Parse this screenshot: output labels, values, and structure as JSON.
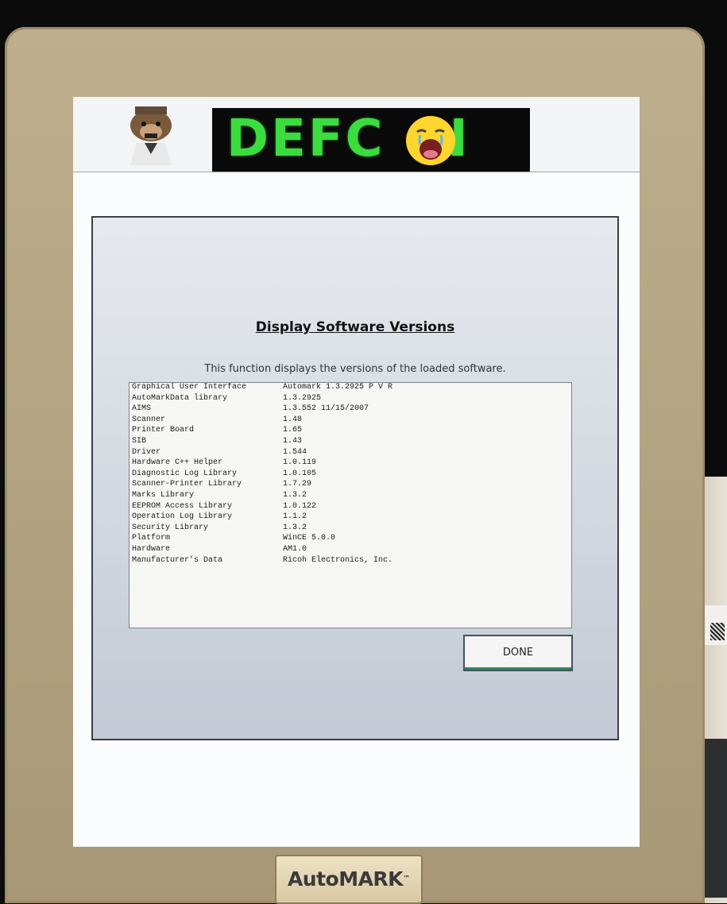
{
  "header": {
    "banner_text": "DEFC  N",
    "logo_icon": "crying-face-icon",
    "mascot_icon": "mascot-icon"
  },
  "dialog": {
    "title": "Display Software Versions",
    "subtitle": "This function displays the versions of the loaded software.",
    "rows": [
      {
        "name": "Graphical User Interface",
        "version": "Automark 1.3.2925 P V R"
      },
      {
        "name": "AutoMarkData library",
        "version": "1.3.2925"
      },
      {
        "name": "AIMS",
        "version": "1.3.552 11/15/2007"
      },
      {
        "name": "Scanner",
        "version": "1.48"
      },
      {
        "name": "Printer Board",
        "version": "1.65"
      },
      {
        "name": "SIB",
        "version": "1.43"
      },
      {
        "name": "Driver",
        "version": "1.544"
      },
      {
        "name": "Hardware C++ Helper",
        "version": "1.0.119"
      },
      {
        "name": "Diagnostic Log Library",
        "version": "1.0.105"
      },
      {
        "name": "Scanner-Printer Library",
        "version": "1.7.29"
      },
      {
        "name": "Marks Library",
        "version": "1.3.2"
      },
      {
        "name": "EEPROM Access Library",
        "version": "1.0.122"
      },
      {
        "name": "Operation Log Library",
        "version": "1.1.2"
      },
      {
        "name": "Security Library",
        "version": "1.3.2"
      },
      {
        "name": "Platform",
        "version": "WinCE 5.0.0"
      },
      {
        "name": "Hardware",
        "version": "AM1.0"
      },
      {
        "name": "Manufacturer's Data",
        "version": "Ricoh Electronics, Inc."
      }
    ],
    "done_label": "DONE"
  },
  "device": {
    "brand": "AutoMARK",
    "brand_mark": "™"
  },
  "colors": {
    "banner_green": "#3bdc3e",
    "panel_bg": "#c3cad5",
    "bezel": "#b6a584"
  }
}
